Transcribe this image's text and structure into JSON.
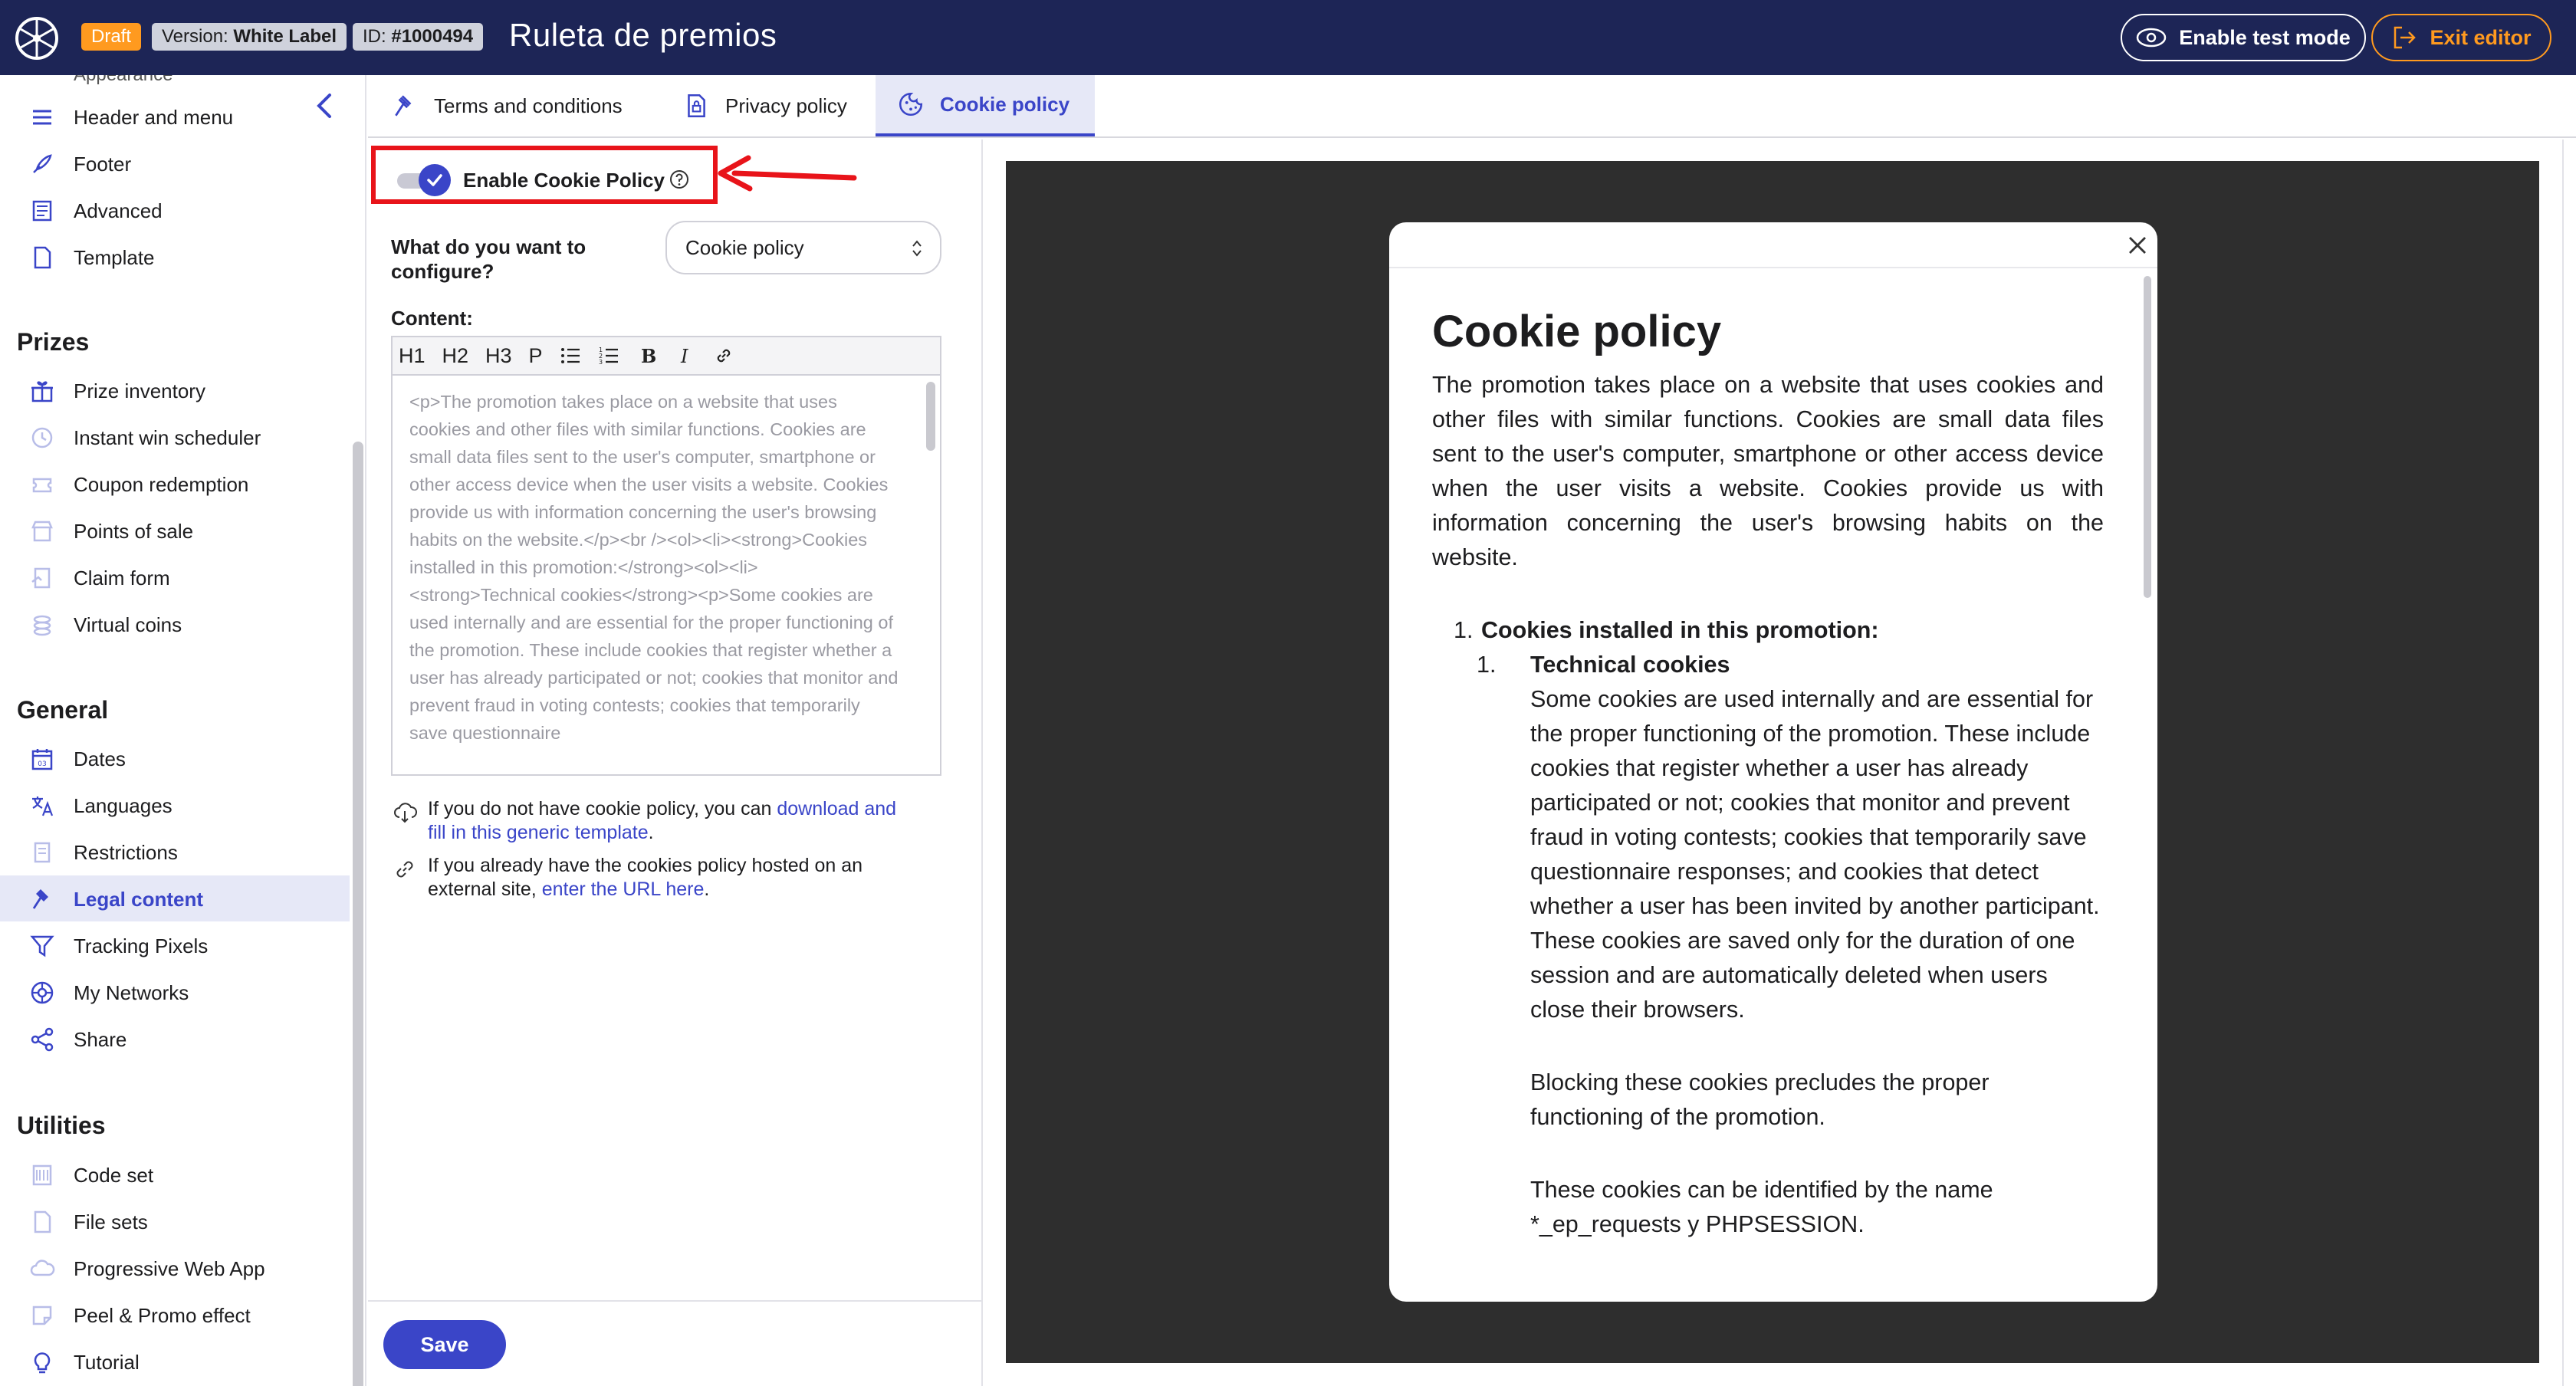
{
  "topbar": {
    "draft": "Draft",
    "version_label": "Version:",
    "version_value": "White Label",
    "id_label": "ID:",
    "id_value": "#1000494",
    "title": "Ruleta de premios",
    "test_mode": "Enable test mode",
    "exit": "Exit editor"
  },
  "sidebar": {
    "cut_item": "Appearance",
    "items_top": [
      {
        "label": "Header and menu",
        "icon": "menu-icon"
      },
      {
        "label": "Footer",
        "icon": "footer-icon"
      },
      {
        "label": "Advanced",
        "icon": "advanced-icon"
      },
      {
        "label": "Template",
        "icon": "template-icon"
      }
    ],
    "prizes_heading": "Prizes",
    "prizes": [
      {
        "label": "Prize inventory",
        "icon": "gift-icon"
      },
      {
        "label": "Instant win scheduler",
        "icon": "clock-icon"
      },
      {
        "label": "Coupon redemption",
        "icon": "coupon-icon"
      },
      {
        "label": "Points of sale",
        "icon": "store-icon"
      },
      {
        "label": "Claim form",
        "icon": "form-icon"
      },
      {
        "label": "Virtual coins",
        "icon": "coins-icon"
      }
    ],
    "general_heading": "General",
    "general": [
      {
        "label": "Dates",
        "icon": "calendar-icon"
      },
      {
        "label": "Languages",
        "icon": "translate-icon"
      },
      {
        "label": "Restrictions",
        "icon": "restrictions-icon"
      },
      {
        "label": "Legal content",
        "icon": "gavel-icon"
      },
      {
        "label": "Tracking Pixels",
        "icon": "filter-icon"
      },
      {
        "label": "My Networks",
        "icon": "network-icon"
      },
      {
        "label": "Share",
        "icon": "share-icon"
      }
    ],
    "utilities_heading": "Utilities",
    "utilities": [
      {
        "label": "Code set",
        "icon": "code-icon"
      },
      {
        "label": "File sets",
        "icon": "file-icon"
      },
      {
        "label": "Progressive Web App",
        "icon": "cloud-icon"
      },
      {
        "label": "Peel & Promo effect",
        "icon": "peel-icon"
      },
      {
        "label": "Tutorial",
        "icon": "bulb-icon"
      }
    ]
  },
  "tabs": [
    {
      "label": "Terms and conditions"
    },
    {
      "label": "Privacy policy"
    },
    {
      "label": "Cookie policy"
    }
  ],
  "config": {
    "toggle_label": "Enable Cookie Policy",
    "toggle_on": true,
    "question": "What do you want to configure?",
    "select_value": "Cookie policy",
    "content_label": "Content:",
    "toolbar": [
      "H1",
      "H2",
      "H3",
      "P"
    ],
    "editor_text": "<p>The promotion takes place on a website that uses cookies and other files with similar functions. Cookies are small data files sent to the user's computer, smartphone or other access device when the user visits a website. Cookies provide us with information concerning the user's browsing habits on the website.</p><br /><ol><li><strong>Cookies installed in this promotion:</strong><ol><li><strong>Technical cookies</strong><p>Some cookies are used internally and are essential for the proper functioning of the promotion. These include cookies that register whether a user has already participated or not; cookies that monitor and prevent fraud in voting contests; cookies that temporarily save questionnaire",
    "hint1_text": "If you do not have cookie policy, you can ",
    "hint1_link": "download and fill in this generic template",
    "hint1_end": ".",
    "hint2_text": "If you already have the cookies policy hosted on an external site, ",
    "hint2_link": "enter the URL here",
    "hint2_end": ".",
    "save": "Save"
  },
  "preview": {
    "title": "Cookie policy",
    "intro": "The promotion takes place on a website that uses cookies and other files with similar functions. Cookies are small data files sent to the user's computer, smartphone or other access device when the user visits a website. Cookies provide us with information concerning the user's browsing habits on the website.",
    "item1_num": "1.",
    "item1": "Cookies installed in this promotion:",
    "item1_1_num": "1.",
    "item1_1": "Technical cookies",
    "p1": "Some cookies are used internally and are essential for the proper functioning of the promotion. These include cookies that register whether a user has already participated or not; cookies that monitor and prevent fraud in voting contests; cookies that temporarily save questionnaire responses; and cookies that detect whether a user has been invited by another participant. These cookies are saved only for the duration of one session and are automatically deleted when users close their browsers.",
    "p2": "Blocking these cookies precludes the proper functioning of the promotion.",
    "p3": "These cookies can be identified by the name *_ep_requests y PHPSESSION."
  },
  "colors": {
    "topbar": "#1d2556",
    "accent": "#3a45c8",
    "draft": "#ff9a1f",
    "highlight": "#e8141a"
  }
}
